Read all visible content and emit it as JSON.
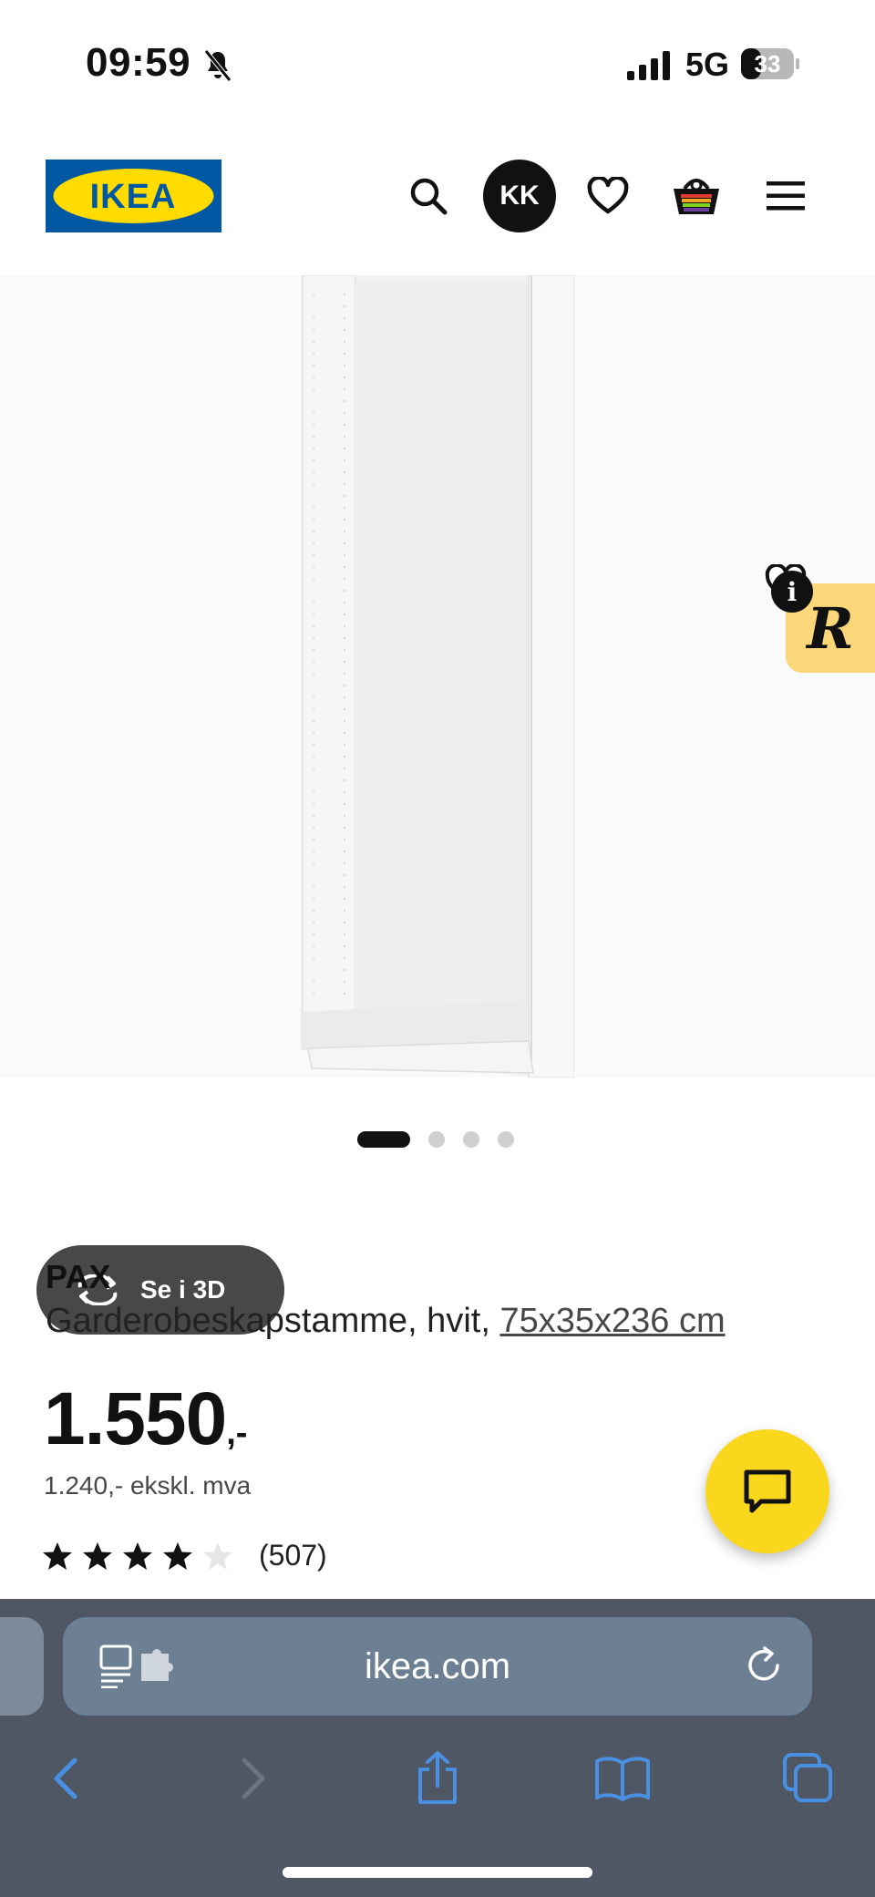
{
  "status": {
    "time": "09:59",
    "network": "5G",
    "battery": "33"
  },
  "header": {
    "logo_text": "IKEA",
    "avatar_initials": "KK"
  },
  "product": {
    "view3d_label": "Se i 3D",
    "gallery_total": 4,
    "gallery_active": 1,
    "name": "PAX",
    "description": "Garderobeskapstamme, hvit,",
    "size": "75x35x236 cm",
    "price_main": "1.550",
    "price_suffix": ",-",
    "price_ex_vat": "1.240,- ekskl. mva",
    "rating_value": 4,
    "rating_max": 5,
    "rating_count": "(507)"
  },
  "browser": {
    "url": "ikea.com"
  },
  "colors": {
    "ikea_blue": "#0058a3",
    "ikea_yellow": "#ffdb00",
    "chat_yellow": "#f9d71c",
    "browser_bg": "#4e5763",
    "ios_blue": "#4a90e2"
  }
}
